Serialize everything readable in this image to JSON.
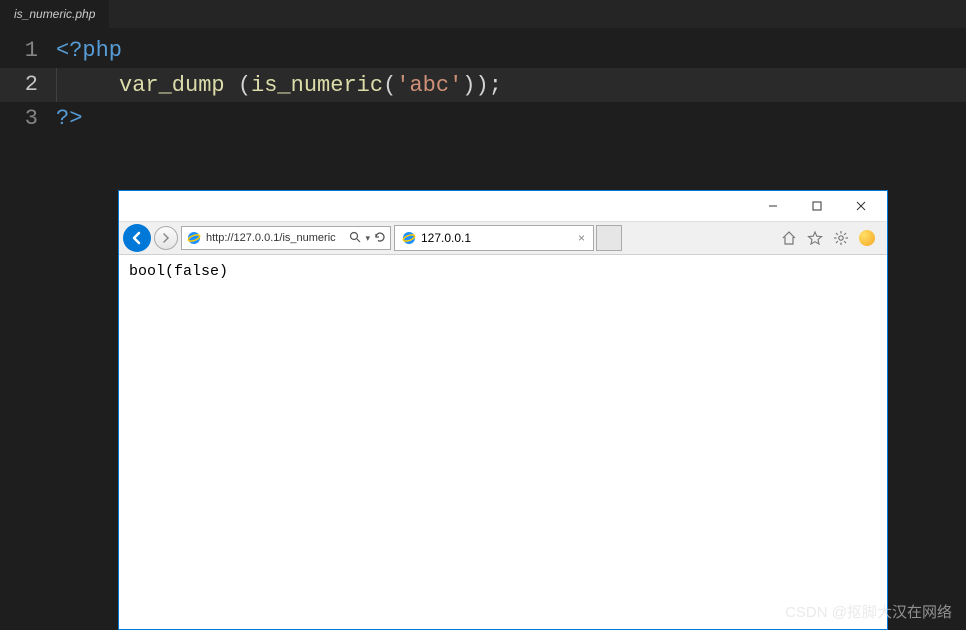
{
  "editor": {
    "tab_name": "is_numeric.php",
    "lines": {
      "l1_num": "1",
      "l2_num": "2",
      "l3_num": "3",
      "php_open": "<?php",
      "php_close": "?>",
      "fn_var_dump": "var_dump",
      "space": " ",
      "paren_open": "(",
      "fn_is_numeric": "is_numeric",
      "str_arg": "'abc'",
      "paren_close": ")",
      "paren_close2": ")",
      "semicolon": ";"
    }
  },
  "browser": {
    "url": "http://127.0.0.1/is_numeric",
    "search_hint": "⌕",
    "refresh_hint": "↻",
    "tab_title": "127.0.0.1",
    "tab_close": "×",
    "page_output": "bool(false)",
    "window_controls": {
      "minimize": "—",
      "maximize": "☐",
      "close": "✕"
    },
    "toolbar_icons": {
      "home": "home-icon",
      "favorites": "star-icon",
      "settings": "gear-icon",
      "smiley": "smiley-icon"
    }
  },
  "watermark": "CSDN @抠脚大汉在网络"
}
